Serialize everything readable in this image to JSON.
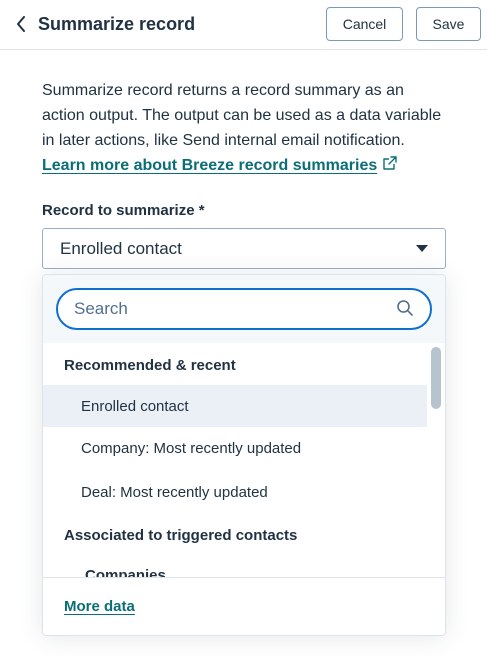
{
  "header": {
    "title": "Summarize record",
    "cancel_label": "Cancel",
    "save_label": "Save",
    "back_icon": "chevron-left-icon"
  },
  "description": {
    "lines": [
      "Summarize record returns a record summary as an",
      "action output. The output can be used as a data variable",
      "in later actions, like Send internal email notification."
    ],
    "link_label": "Learn more about Breeze record summaries",
    "link_icon": "external-link-icon"
  },
  "field": {
    "label": "Record to summarize *",
    "selected_value": "Enrolled contact"
  },
  "dropdown": {
    "search_placeholder": "Search",
    "groups": [
      {
        "header": "Recommended & recent",
        "options": [
          "Enrolled contact",
          "Company: Most recently updated",
          "Deal: Most recently updated"
        ]
      },
      {
        "header": "Associated to triggered contacts",
        "sub_header": "Companies"
      }
    ],
    "footer_link": "More data"
  },
  "colors": {
    "link": "#0b6e77",
    "focus": "#0f6fd1",
    "text": "#213343",
    "selected_bg": "#eaf0f6"
  }
}
